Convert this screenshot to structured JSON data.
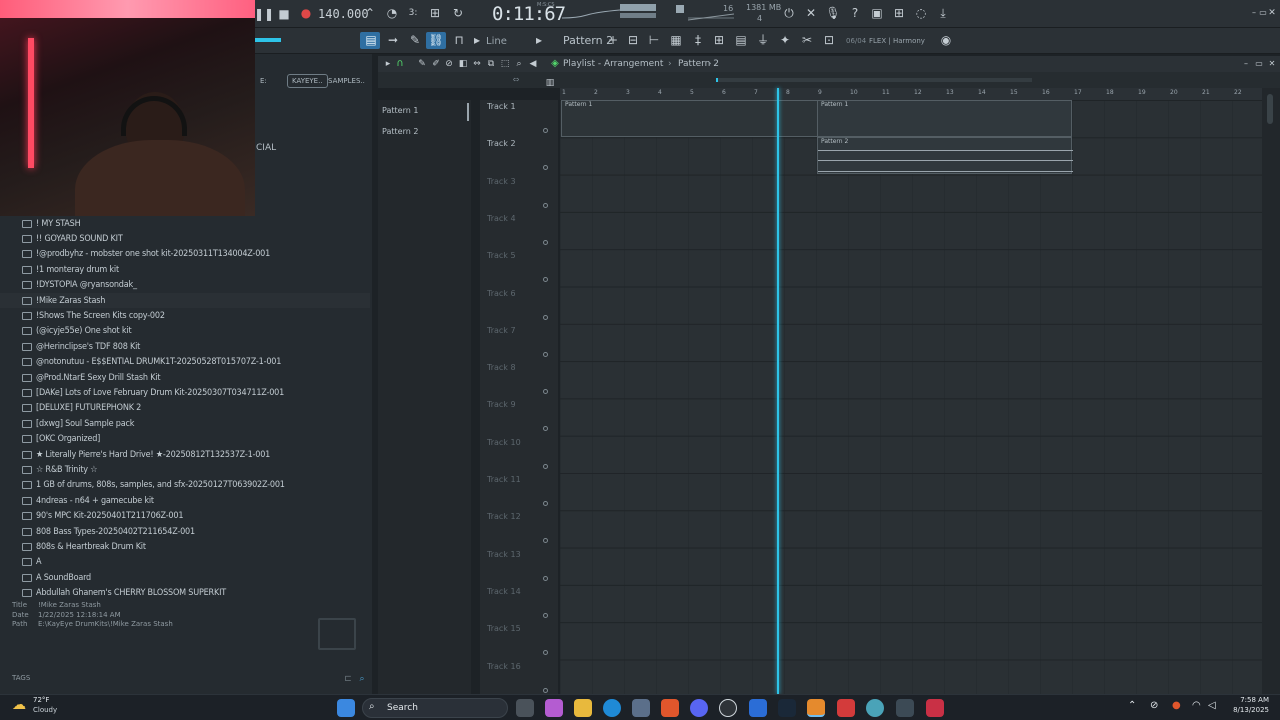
{
  "toolbar": {
    "tempo": "140.000",
    "time": "0:11:67",
    "time_unit": "M:S:CS",
    "cpu_top": "16",
    "memory": "1381 MB",
    "voices": "4",
    "snap_mode": "Line",
    "pattern": "Pattern 2",
    "hint_date": "06/04",
    "hint_text": "FLEX | Harmony"
  },
  "browser": {
    "partial_tab": "E:",
    "tab_kayeye": "KAYEYE..",
    "tab_samples": "SAMPLES..",
    "partial_text": "CIAL",
    "items": [
      "! MY STASH",
      "!! GOYARD SOUND KIT",
      "!@prodbyhz - mobster one shot kit-20250311T134004Z-001",
      "!1 monteray drum kit",
      "!DYSTOPIA @ryansondak_",
      "!Mike Zaras Stash",
      "!Shows The Screen Kits copy-002",
      "(@icyje55e) One shot kit",
      "@Herinclipse's TDF 808 Kit",
      "@notonutuu - E$$ENTIAL DRUMK1T-20250528T015707Z-1-001",
      "@Prod.NtarE Sexy Drill Stash Kit",
      "[DAKe] Lots of Love February Drum Kit-20250307T034711Z-001",
      "[DELUXE] FUTUREPHONK 2",
      "[dxwg] Soul Sample pack",
      "[OKC Organized]",
      "★ Literally Pierre's Hard Drive! ★-20250812T132537Z-1-001",
      "☆ R&B Trinity ☆",
      "1 GB of drums, 808s, samples, and sfx-20250127T063902Z-001",
      "4ndreas - n64 + gamecube kit",
      "90's MPC Kit-20250401T211706Z-001",
      "808 Bass Types-20250402T211654Z-001",
      "808s & Heartbreak Drum Kit",
      "A",
      "A SoundBoard",
      "Abdullah Ghanem's CHERRY BLOSSOM SUPERKIT"
    ],
    "info": {
      "title_label": "Title",
      "title": "!Mike Zaras Stash",
      "date_label": "Date",
      "date": "1/22/2025 12:18:14 AM",
      "path_label": "Path",
      "path": "E:\\KayEye DrumKits\\!Mike Zaras Stash"
    },
    "tags_label": "TAGS"
  },
  "playlist": {
    "title": "Playlist - Arrangement",
    "pattern": "Pattern 2",
    "patterns": [
      "Pattern 1",
      "Pattern 2"
    ],
    "tracks": [
      "Track 1",
      "Track 2",
      "Track 3",
      "Track 4",
      "Track 5",
      "Track 6",
      "Track 7",
      "Track 8",
      "Track 9",
      "Track 10",
      "Track 11",
      "Track 12",
      "Track 13",
      "Track 14",
      "Track 15",
      "Track 16"
    ],
    "ruler": [
      "1",
      "2",
      "3",
      "4",
      "5",
      "6",
      "7",
      "8",
      "9",
      "10",
      "11",
      "12",
      "13",
      "14",
      "15",
      "16",
      "17",
      "18",
      "19",
      "20",
      "21",
      "22"
    ],
    "clips": {
      "c1": "Pattern 1",
      "c2": "Pattern 1",
      "c3": "Pattern 2"
    },
    "playhead_bar": 7.8
  },
  "taskbar": {
    "temp": "72°F",
    "weather": "Cloudy",
    "search": "Search",
    "time": "7:58 AM",
    "date": "8/13/2025"
  },
  "colors": {
    "accent": "#2ec4e8",
    "bg": "#1d2226"
  }
}
